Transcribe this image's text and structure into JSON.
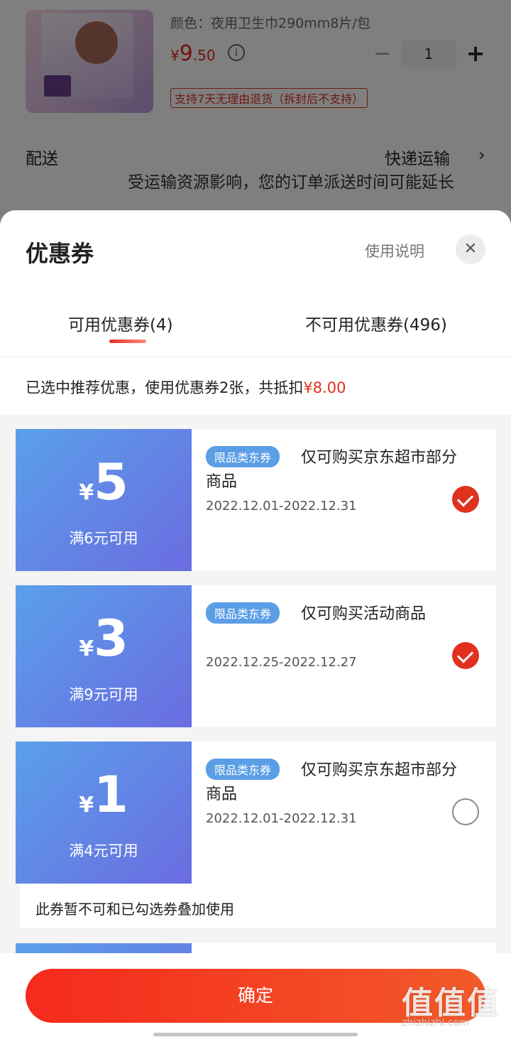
{
  "product": {
    "sku": "颜色：夜用卫生巾290mm8片/包",
    "price_symbol": "¥",
    "price_int": "9",
    "price_dec": ".50",
    "info_icon": "info-icon",
    "quantity": "1",
    "minus": "−",
    "plus": "+",
    "return_tag": "支持7天无理由退货（拆封后不支持）"
  },
  "shipping": {
    "label": "配送",
    "value": "快递运输",
    "arrow": "›",
    "note": "受运输资源影响，您的订单派送时间可能延长"
  },
  "sheet": {
    "title": "优惠券",
    "usage": "使用说明",
    "close": "✕",
    "tabs": [
      {
        "label": "可用优惠券(4)"
      },
      {
        "label": "不可用优惠券(496)"
      }
    ],
    "summary_prefix": "已选中推荐优惠，使用优惠券2张，共抵扣",
    "summary_amount": "¥8.00"
  },
  "coupons": [
    {
      "yen": "¥",
      "amount": "5",
      "condition": "满6元可用",
      "badge": "限品类东券",
      "desc": "仅可购买京东超市部分商品",
      "date": "2022.12.01-2022.12.31",
      "selected": true
    },
    {
      "yen": "¥",
      "amount": "3",
      "condition": "满9元可用",
      "badge": "限品类东券",
      "desc": "仅可购买活动商品",
      "date": "2022.12.25-2022.12.27",
      "selected": true
    },
    {
      "yen": "¥",
      "amount": "1",
      "condition": "满4元可用",
      "badge": "限品类东券",
      "desc": "仅可购买京东超市部分商品",
      "date": "2022.12.01-2022.12.31",
      "selected": false
    }
  ],
  "coupon_note": "此券暂不可和已勾选券叠加使用",
  "confirm": "确定",
  "watermark": {
    "logo": "值值值",
    "site": "zhizhizhi.com"
  },
  "colors": {
    "accent": "#e0301e",
    "coupon_gradient_start": "#5aa0ea",
    "coupon_gradient_end": "#6a6ce0"
  }
}
